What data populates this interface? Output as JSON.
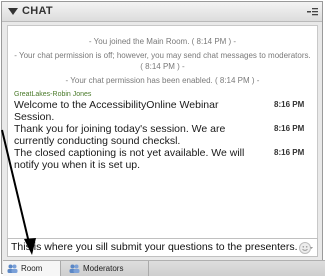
{
  "chat": {
    "title": "CHAT",
    "menu_icon": "pod-menu-icon",
    "system_messages": [
      "- You joined the Main Room. ( 8:14 PM ) -",
      "- Your chat permission is off; however, you may send chat messages to moderators. ( 8:14 PM ) -",
      "- Your chat permission has been enabled. ( 8:14 PM ) -"
    ],
    "sender": "GreatLakes-Robin Jones",
    "messages": [
      {
        "text": "Welcome to the AccessibilityOnline Webinar Session.",
        "time": "8:16 PM"
      },
      {
        "text": "Thank you for joining today's session. We are currently conducting sound checksl.",
        "time": "8:16 PM"
      },
      {
        "text": "The closed captioning is not yet available. We will notify you when it is set up.",
        "time": "8:16 PM"
      }
    ],
    "input_value": "This is where you sill submit your questions to the presenters.",
    "tabs": [
      {
        "label": "Room",
        "icon": "users-icon",
        "active": true
      },
      {
        "label": "Moderators",
        "icon": "users-icon",
        "active": false
      }
    ]
  }
}
